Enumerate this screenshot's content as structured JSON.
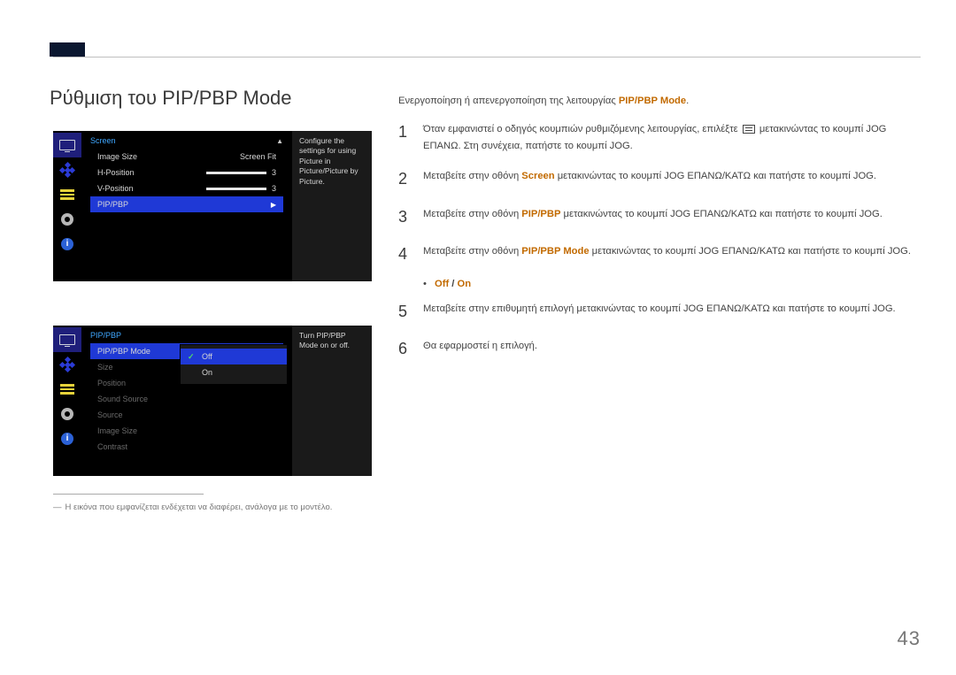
{
  "page_number": "43",
  "title": "Ρύθμιση του PIP/PBP Mode",
  "intro_prefix": "Ενεργοποίηση ή απενεργοποίηση της λειτουργίας ",
  "intro_hl": "PIP/PBP Mode",
  "intro_suffix": ".",
  "steps": {
    "s1": {
      "num": "1",
      "pre": "Όταν εμφανιστεί ο οδηγός κουμπιών ρυθμιζόμενης λειτουργίας, επιλέξτε ",
      "post": " μετακινώντας το κουμπί JOG ΕΠΑΝΩ. Στη συνέχεια, πατήστε το κουμπί JOG."
    },
    "s2": {
      "num": "2",
      "pre": "Μεταβείτε στην οθόνη ",
      "hl": "Screen",
      "post": " μετακινώντας το κουμπί JOG ΕΠΑΝΩ/ΚΑΤΩ και πατήστε το κουμπί JOG."
    },
    "s3": {
      "num": "3",
      "pre": "Μεταβείτε στην οθόνη ",
      "hl": "PIP/PBP",
      "post": " μετακινώντας το κουμπί JOG ΕΠΑΝΩ/ΚΑΤΩ και πατήστε το κουμπί JOG."
    },
    "s4": {
      "num": "4",
      "pre": "Μεταβείτε στην οθόνη ",
      "hl": "PIP/PBP Mode",
      "post": " μετακινώντας το κουμπί JOG ΕΠΑΝΩ/ΚΑΤΩ και πατήστε το κουμπί JOG."
    },
    "s5": {
      "num": "5",
      "text": "Μεταβείτε στην επιθυμητή επιλογή μετακινώντας το κουμπί JOG ΕΠΑΝΩ/ΚΑΤΩ και πατήστε το κουμπί JOG."
    },
    "s6": {
      "num": "6",
      "text": "Θα εφαρμοστεί η επιλογή."
    }
  },
  "bullet": {
    "off": "Off",
    "slash": " / ",
    "on": "On"
  },
  "osd1": {
    "crumb": "Screen",
    "rows": {
      "r0": {
        "label": "Image Size",
        "value": "Screen Fit"
      },
      "r1": {
        "label": "H-Position",
        "value": "3"
      },
      "r2": {
        "label": "V-Position",
        "value": "3"
      },
      "r3": {
        "label": "PIP/PBP"
      }
    },
    "desc": "Configure the settings for using Picture in Picture/Picture by Picture."
  },
  "osd2": {
    "crumb": "PIP/PBP",
    "rows": {
      "r0": "PIP/PBP Mode",
      "r1": "Size",
      "r2": "Position",
      "r3": "Sound Source",
      "r4": "Source",
      "r5": "Image Size",
      "r6": "Contrast"
    },
    "submenu": {
      "off": "Off",
      "on": "On"
    },
    "desc": "Turn PIP/PBP Mode on or off."
  },
  "footnote": "Η εικόνα που εμφανίζεται ενδέχεται να διαφέρει, ανάλογα με το μοντέλο.",
  "info_glyph": "i"
}
